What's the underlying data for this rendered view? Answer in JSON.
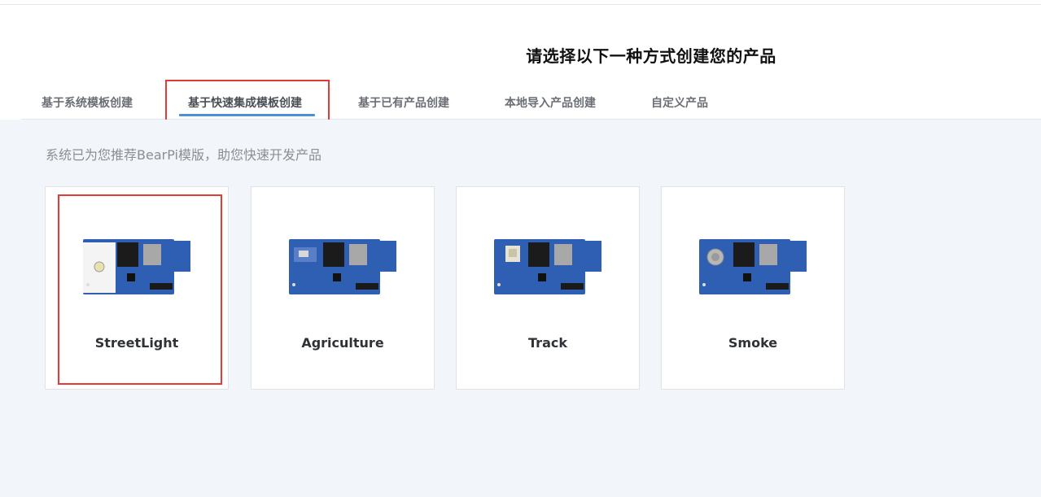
{
  "header": {
    "title": "请选择以下一种方式创建您的产品"
  },
  "tabs": [
    {
      "label": "基于系统模板创建",
      "active": false
    },
    {
      "label": "基于快速集成模板创建",
      "active": true
    },
    {
      "label": "基于已有产品创建",
      "active": false
    },
    {
      "label": "本地导入产品创建",
      "active": false
    },
    {
      "label": "自定义产品",
      "active": false
    }
  ],
  "main": {
    "hint": "系统已为您推荐BearPi模版，助您快速开发产品",
    "templates": [
      {
        "label": "StreetLight",
        "icon": "streetlight-board-image",
        "selected": true
      },
      {
        "label": "Agriculture",
        "icon": "agriculture-board-image",
        "selected": false
      },
      {
        "label": "Track",
        "icon": "track-board-image",
        "selected": false
      },
      {
        "label": "Smoke",
        "icon": "smoke-board-image",
        "selected": false
      }
    ]
  },
  "colors": {
    "accent": "#4a90d9",
    "annotation": "#e53935",
    "content_bg": "#f2f5f9",
    "board_blue": "#2f5fb3"
  }
}
